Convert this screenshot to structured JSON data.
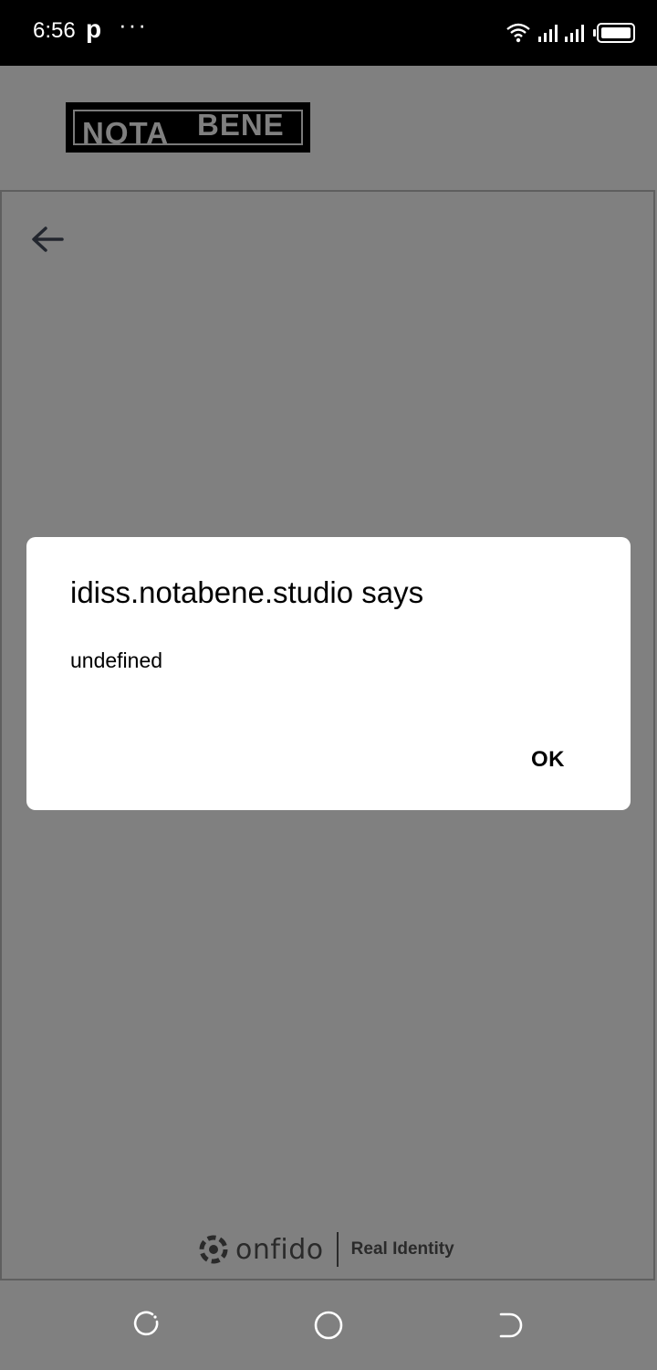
{
  "status_bar": {
    "time": "6:56",
    "app_icon": "p",
    "more": "···"
  },
  "logo": {
    "left_text": "NOTA",
    "right_text": "BENE"
  },
  "dialog": {
    "title": "idiss.notabene.studio says",
    "message": "undefined",
    "ok_label": "OK"
  },
  "footer": {
    "brand": "onfido",
    "tagline": "Real Identity"
  },
  "icons": {
    "back": "arrow-left-icon",
    "recents": "recents-icon",
    "home": "home-icon",
    "nav_back": "back-nav-icon"
  },
  "colors": {
    "scrim": "#808080",
    "status_bar": "#000000",
    "dialog_bg": "#ffffff"
  }
}
